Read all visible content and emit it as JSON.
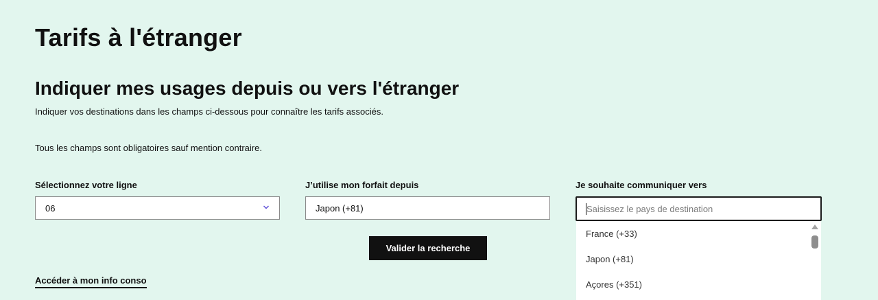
{
  "page": {
    "title": "Tarifs à l'étranger"
  },
  "section": {
    "title": "Indiquer mes usages depuis ou vers l'étranger",
    "intro": "Indiquer vos destinations dans les champs ci-dessous pour connaître les tarifs associés.",
    "required_note": "Tous les champs sont obligatoires sauf mention contraire."
  },
  "form": {
    "line": {
      "label": "Sélectionnez votre ligne",
      "value": "06",
      "icon": "chevron-down-icon"
    },
    "from": {
      "label": "J’utilise mon forfait depuis",
      "value": "Japon (+81)"
    },
    "to": {
      "label": "Je souhaite communiquer vers",
      "value": "",
      "placeholder": "Saisissez le pays de destination",
      "options": [
        "France (+33)",
        "Japon (+81)",
        "Açores (+351)"
      ]
    },
    "submit_label": "Valider la recherche"
  },
  "links": {
    "info_conso": "Accéder à mon info conso"
  },
  "colors": {
    "background": "#e2f6ee",
    "button": "#111111",
    "chevron": "#5b4bd6"
  }
}
